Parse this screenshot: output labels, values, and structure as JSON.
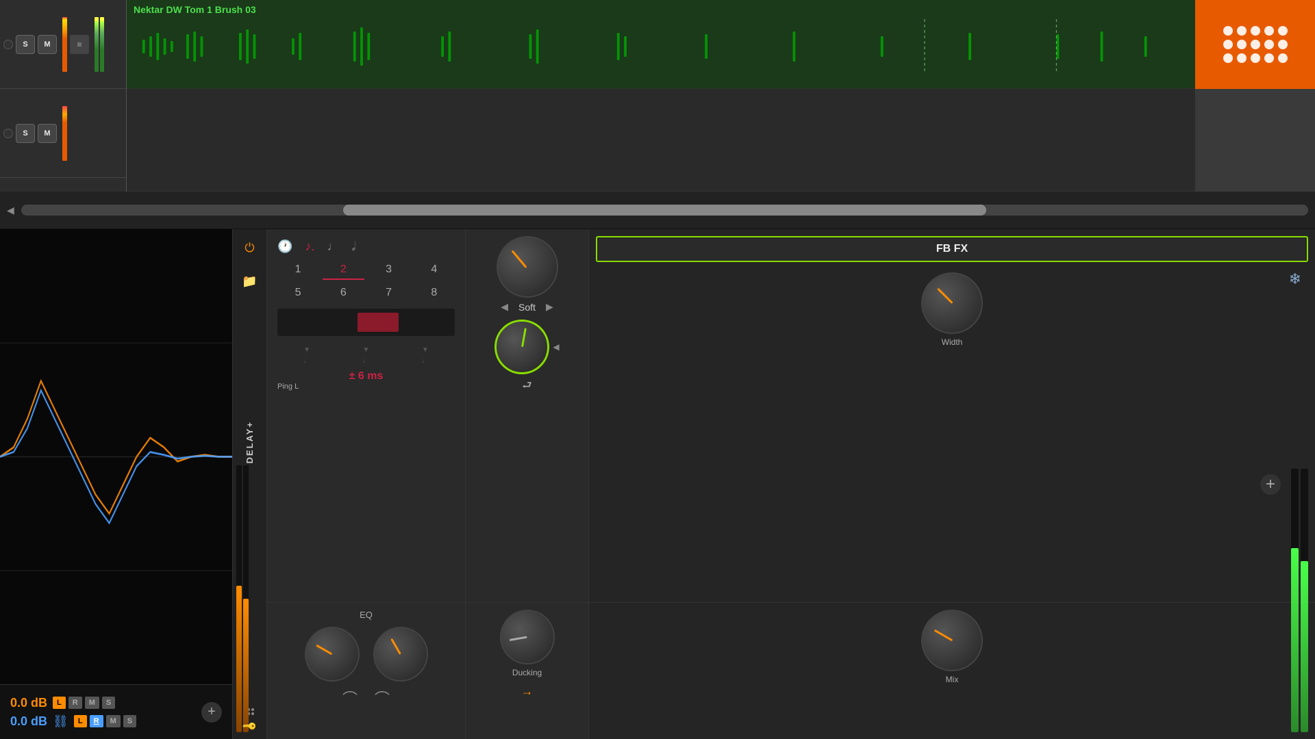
{
  "daw": {
    "track1": {
      "name": "Nektar DW Tom 1 Brush 03",
      "s_label": "S",
      "m_label": "M"
    },
    "track2": {
      "s_label": "S",
      "m_label": "M"
    }
  },
  "analyzer": {
    "db_orange": "0.0 dB",
    "db_blue": "0.0 dB",
    "ch_buttons": [
      "L",
      "R",
      "M",
      "S"
    ],
    "ch_buttons2": [
      "L",
      "R",
      "M",
      "S"
    ]
  },
  "plugin": {
    "name": "DELAY+",
    "power_active": true,
    "tab": "Ping L",
    "note_icons": [
      "♩",
      "♪",
      "♩",
      "♩"
    ],
    "grid": [
      "1",
      "2",
      "3",
      "4",
      "5",
      "6",
      "7",
      "8"
    ],
    "active_grid": "2",
    "delay_ms": "± 6 ms",
    "soft_label": "Soft",
    "eq_label": "EQ",
    "ducking_label": "Ducking",
    "width_label": "Width",
    "mix_label": "Mix",
    "fbfx_label": "FB FX"
  },
  "add_buttons": {
    "left": "+",
    "right": "+"
  }
}
